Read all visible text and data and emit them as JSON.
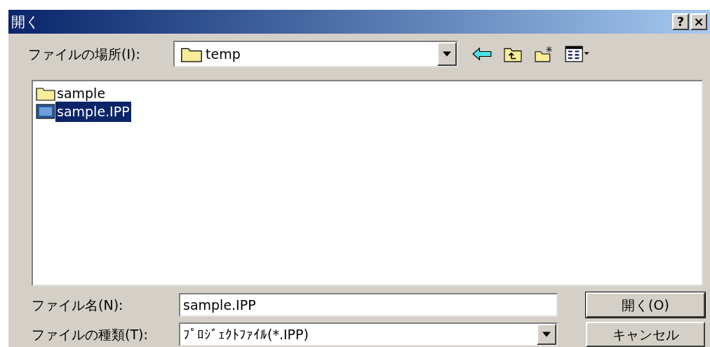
{
  "window": {
    "title": "開く",
    "buttons": [
      "?",
      "×"
    ]
  },
  "location": {
    "label": "ファイルの場所(I):",
    "value": "temp"
  },
  "files": [
    {
      "name": "sample",
      "kind": "folder",
      "selected": false
    },
    {
      "name": "sample.IPP",
      "kind": "project",
      "selected": true
    }
  ],
  "filename": {
    "label": "ファイル名(N):",
    "value": "sample.IPP"
  },
  "filetype": {
    "label": "ファイルの種類(T):",
    "value": "ﾌﾟﾛｼﾞｪｸﾄﾌｧｲﾙ(*.IPP)"
  },
  "buttons": [
    "開く(O)",
    "キャンセル"
  ]
}
